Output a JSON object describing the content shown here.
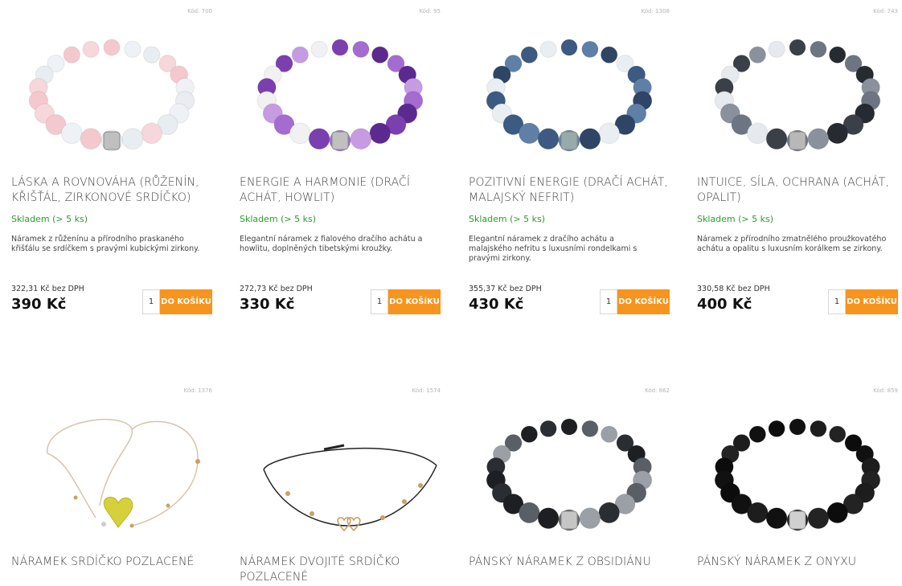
{
  "products": [
    {
      "code": "Kód: 700",
      "name": "LÁSKA A ROVNOVÁHA (RŮŽENÍN, KŘIŠŤÁL, ZIRKONOVÉ SRDÍČKO)",
      "stock": "Skladem (> 5 ks)",
      "desc": "Náramek z růženínu a přírodního praskaného křišťálu se srdíčkem s pravými kubickými zirkony.",
      "netto": "322,31 Kč bez DPH",
      "price": "390 Kč",
      "qty": "1",
      "buy": "DO KOŠÍKU",
      "icon": "rose-quartz-bracelet-icon"
    },
    {
      "code": "Kód: 95",
      "name": "ENERGIE A HARMONIE (DRAČÍ ACHÁT, HOWLIT)",
      "stock": "Skladem (> 5 ks)",
      "desc": "Elegantní náramek z fialového dračího achátu a howlitu, doplněných tibetskými kroužky.",
      "netto": "272,73 Kč bez DPH",
      "price": "330 Kč",
      "qty": "1",
      "buy": "DO KOŠÍKU",
      "icon": "purple-agate-bracelet-icon"
    },
    {
      "code": "Kód: 1308",
      "name": "POZITIVNÍ ENERGIE (DRAČÍ ACHÁT, MALAJSKÝ NEFRIT)",
      "stock": "Skladem (> 5 ks)",
      "desc": "Elegantní náramek z dračího achátu a malajského nefritu s luxusními rondelkami s pravými zirkony.",
      "netto": "355,37 Kč bez DPH",
      "price": "430 Kč",
      "qty": "1",
      "buy": "DO KOŠÍKU",
      "icon": "blue-agate-bracelet-icon"
    },
    {
      "code": "Kód: 743",
      "name": "INTUICE, SÍLA, OCHRANA (ACHÁT, OPALIT)",
      "stock": "Skladem (> 5 ks)",
      "desc": "Náramek z přírodního zmatnělého proužkovatého achátu a opalitu s luxusním korálkem se zirkony.",
      "netto": "330,58 Kč bez DPH",
      "price": "400 Kč",
      "qty": "1",
      "buy": "DO KOŠÍKU",
      "icon": "grey-agate-bracelet-icon"
    },
    {
      "code": "Kód: 1376",
      "name": "NÁRAMEK SRDÍČKO POZLACENÉ",
      "icon": "gold-heart-cord-bracelet-icon"
    },
    {
      "code": "Kód: 1574",
      "name": "NÁRAMEK DVOJITÉ SRDÍČKO POZLACENÉ",
      "icon": "double-heart-cord-bracelet-icon"
    },
    {
      "code": "Kód: 862",
      "name": "PÁNSKÝ NÁRAMEK Z OBSIDIÁNU",
      "icon": "obsidian-bracelet-icon"
    },
    {
      "code": "Kód: 859",
      "name": "PÁNSKÝ NÁRAMEK Z ONYXU",
      "icon": "onyx-bracelet-icon"
    }
  ],
  "colors": {
    "buy_button": "#f7941d",
    "stock": "#2c9a2c"
  }
}
